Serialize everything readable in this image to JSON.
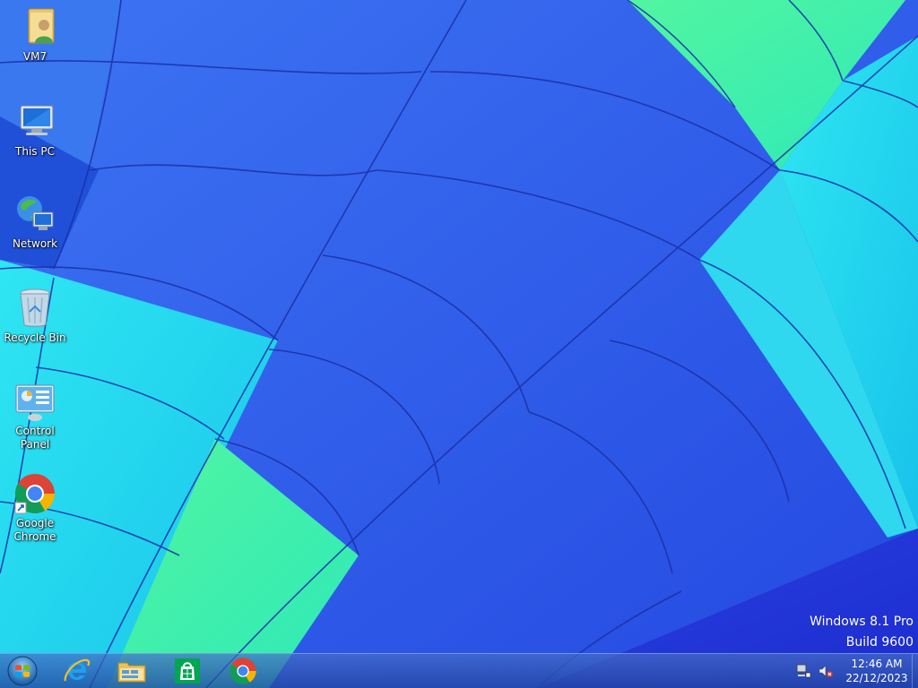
{
  "desktop": {
    "icons": [
      {
        "label": "VM7",
        "icon": "user-folder-icon"
      },
      {
        "label": "This PC",
        "icon": "computer-icon"
      },
      {
        "label": "Network",
        "icon": "network-icon"
      },
      {
        "label": "Recycle Bin",
        "icon": "recycle-bin-icon"
      },
      {
        "label": "Control Panel",
        "icon": "control-panel-icon"
      },
      {
        "label": "Google\nChrome",
        "icon": "chrome-icon"
      }
    ]
  },
  "watermark": {
    "edition": "Windows 8.1 Pro",
    "build": "Build 9600"
  },
  "taskbar": {
    "start": {
      "icon": "windows-start-orb-icon"
    },
    "pinned": [
      {
        "icon": "internet-explorer-icon"
      },
      {
        "icon": "file-explorer-icon"
      },
      {
        "icon": "windows-store-icon"
      },
      {
        "icon": "chrome-icon"
      }
    ],
    "tray": {
      "icons": [
        "network-status-icon",
        "volume-muted-icon"
      ],
      "time": "12:46 AM",
      "date": "22/12/2023"
    }
  },
  "colors": {
    "wallpaper_blue": "#2a5ee8",
    "wallpaper_cyan": "#22d7ee",
    "wallpaper_green": "#3ef0a8",
    "taskbar": "#2c5ab8"
  }
}
